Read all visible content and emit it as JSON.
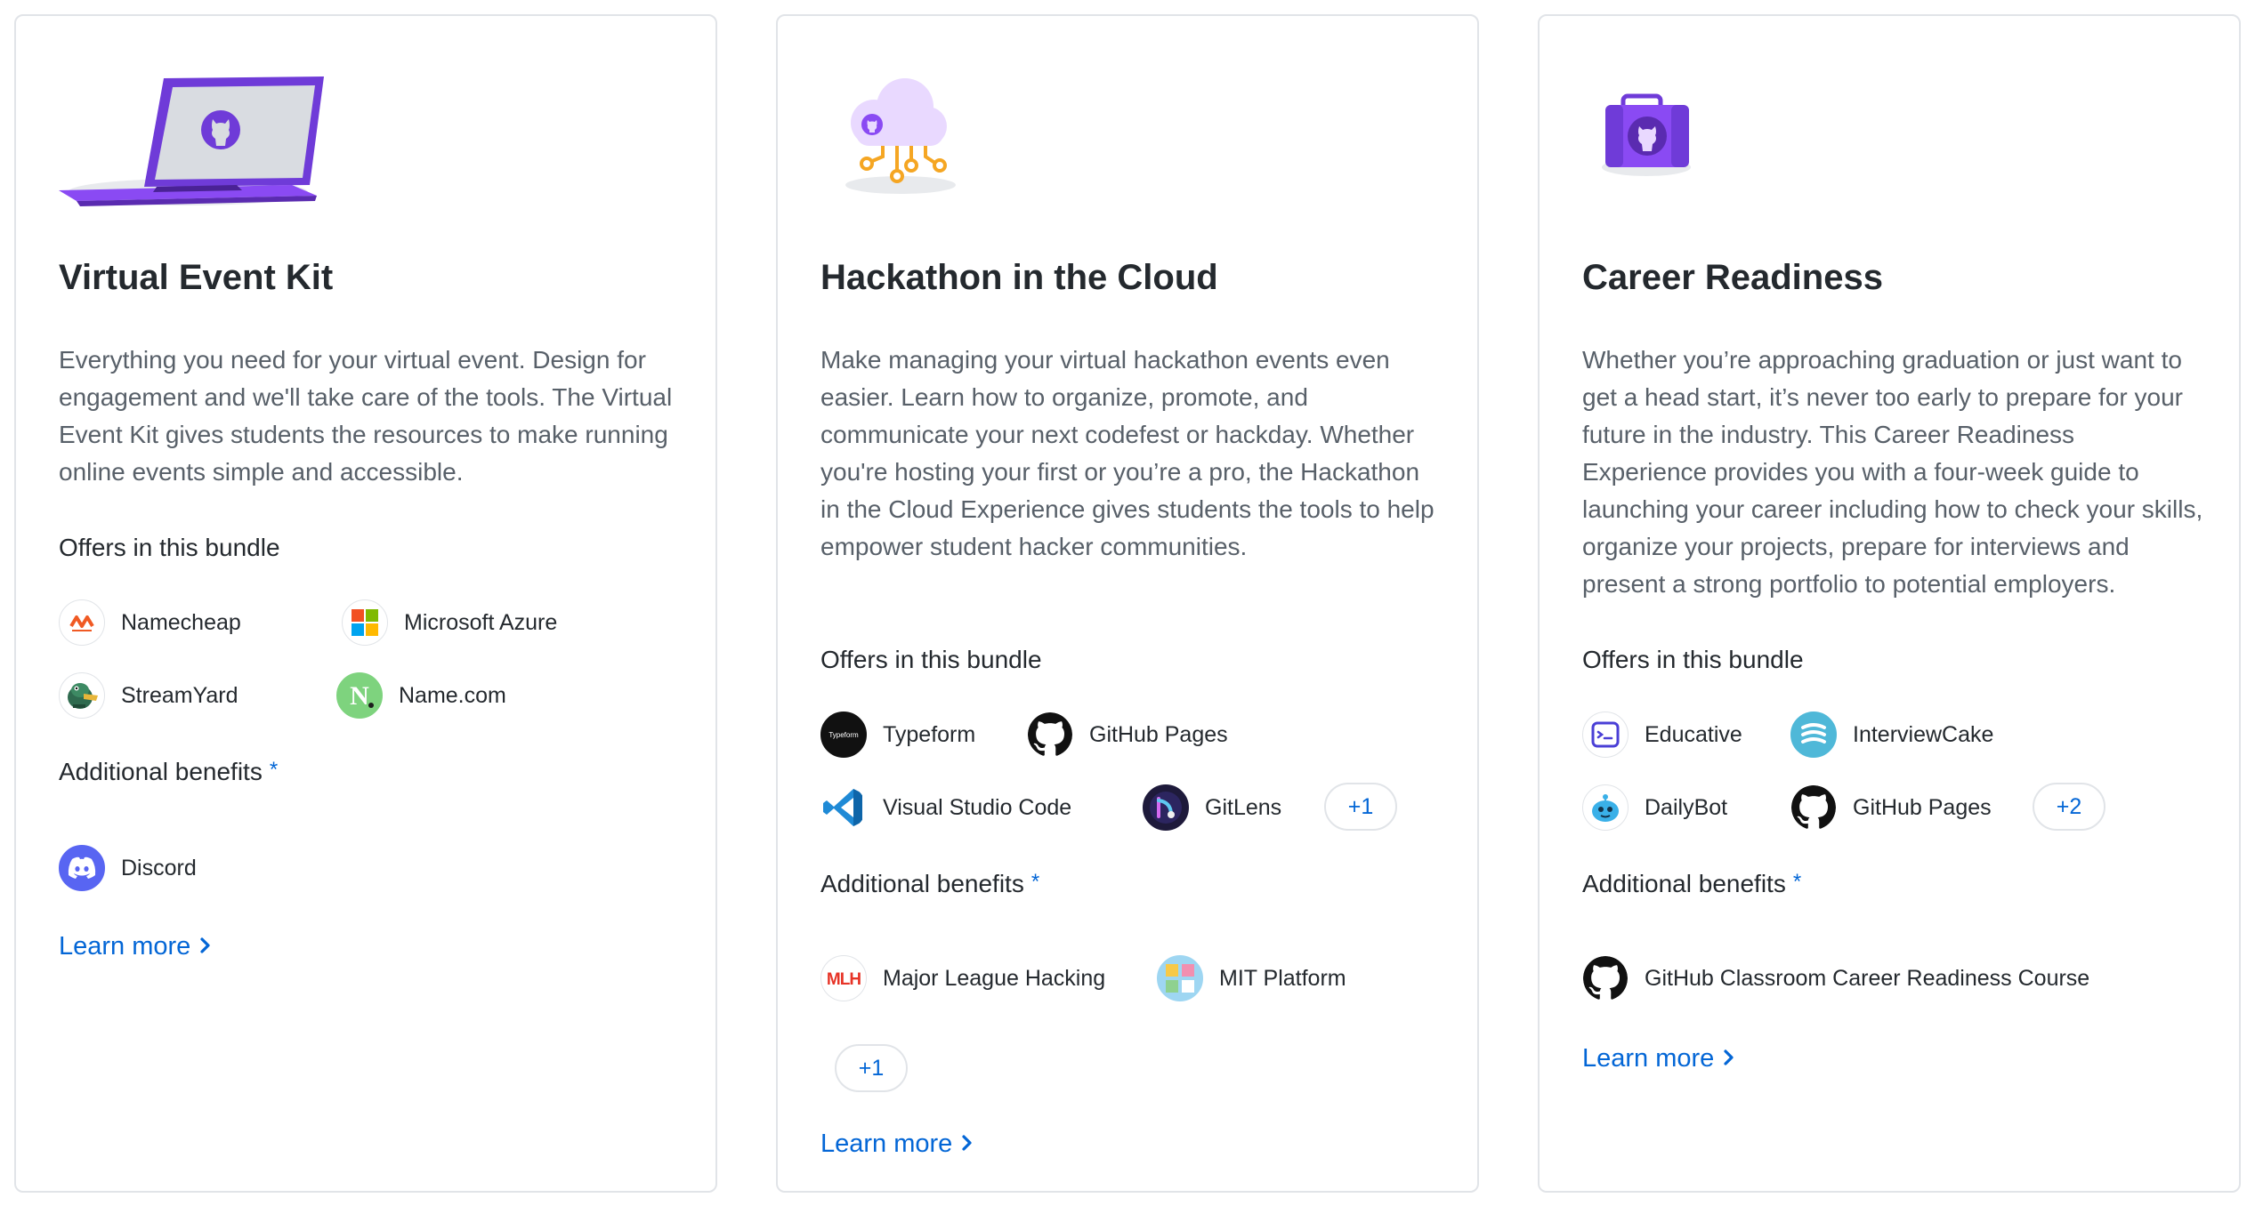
{
  "cards": [
    {
      "title": "Virtual Event Kit",
      "description": "Everything you need for your virtual event. Design for engagement and we'll take care of the tools. The Virtual Event Kit gives students the resources to make running online events simple and accessible.",
      "offers_label": "Offers in this bundle",
      "offers": [
        {
          "name": "Namecheap",
          "icon": "namecheap-logo"
        },
        {
          "name": "Microsoft Azure",
          "icon": "microsoft-logo"
        },
        {
          "name": "StreamYard",
          "icon": "streamyard-logo"
        },
        {
          "name": "Name.com",
          "icon": "namecom-logo"
        }
      ],
      "benefits_label": "Additional benefits",
      "benefits_marker": "*",
      "benefits": [
        {
          "name": "Discord",
          "icon": "discord-logo"
        }
      ],
      "learn_more": "Learn more"
    },
    {
      "title": "Hackathon in the Cloud",
      "description": "Make managing your virtual hackathon events even easier. Learn how to organize, promote, and communicate your next codefest or hackday. Whether you're hosting your first or you’re a pro, the Hackathon in the Cloud Experience gives students the tools to help empower student hacker communities.",
      "offers_label": "Offers in this bundle",
      "offers": [
        {
          "name": "Typeform",
          "icon": "typeform-logo",
          "logo_text": "Typeform"
        },
        {
          "name": "GitHub Pages",
          "icon": "github-logo"
        },
        {
          "name": "Visual Studio Code",
          "icon": "vscode-logo"
        },
        {
          "name": "GitLens",
          "icon": "gitlens-logo"
        }
      ],
      "offers_more": "+1",
      "benefits_label": "Additional benefits",
      "benefits_marker": "*",
      "benefits": [
        {
          "name": "Major League Hacking",
          "icon": "mlh-logo",
          "logo_text": "MLH"
        },
        {
          "name": "MIT Platform",
          "icon": "mit-platform-logo"
        }
      ],
      "benefits_more": "+1",
      "learn_more": "Learn more"
    },
    {
      "title": "Career Readiness",
      "description": "Whether you’re approaching graduation or just want to get a head start, it’s never too early to prepare for your future in the industry. This Career Readiness Experience provides you with a four-week guide to launching your career including how to check your skills, organize your projects, prepare for interviews and present a strong portfolio to potential employers.",
      "offers_label": "Offers in this bundle",
      "offers": [
        {
          "name": "Educative",
          "icon": "educative-logo"
        },
        {
          "name": "InterviewCake",
          "icon": "interviewcake-logo"
        },
        {
          "name": "DailyBot",
          "icon": "dailybot-logo"
        },
        {
          "name": "GitHub Pages",
          "icon": "github-logo"
        }
      ],
      "offers_more": "+2",
      "benefits_label": "Additional benefits",
      "benefits_marker": "*",
      "benefits": [
        {
          "name": "GitHub Classroom Career Readiness Course",
          "icon": "github-logo"
        }
      ],
      "learn_more": "Learn more"
    }
  ],
  "colors": {
    "accent": "#0366d6",
    "title": "#24292e",
    "muted": "#586069",
    "border": "#e1e4e8",
    "purple": "#8a4af3"
  }
}
